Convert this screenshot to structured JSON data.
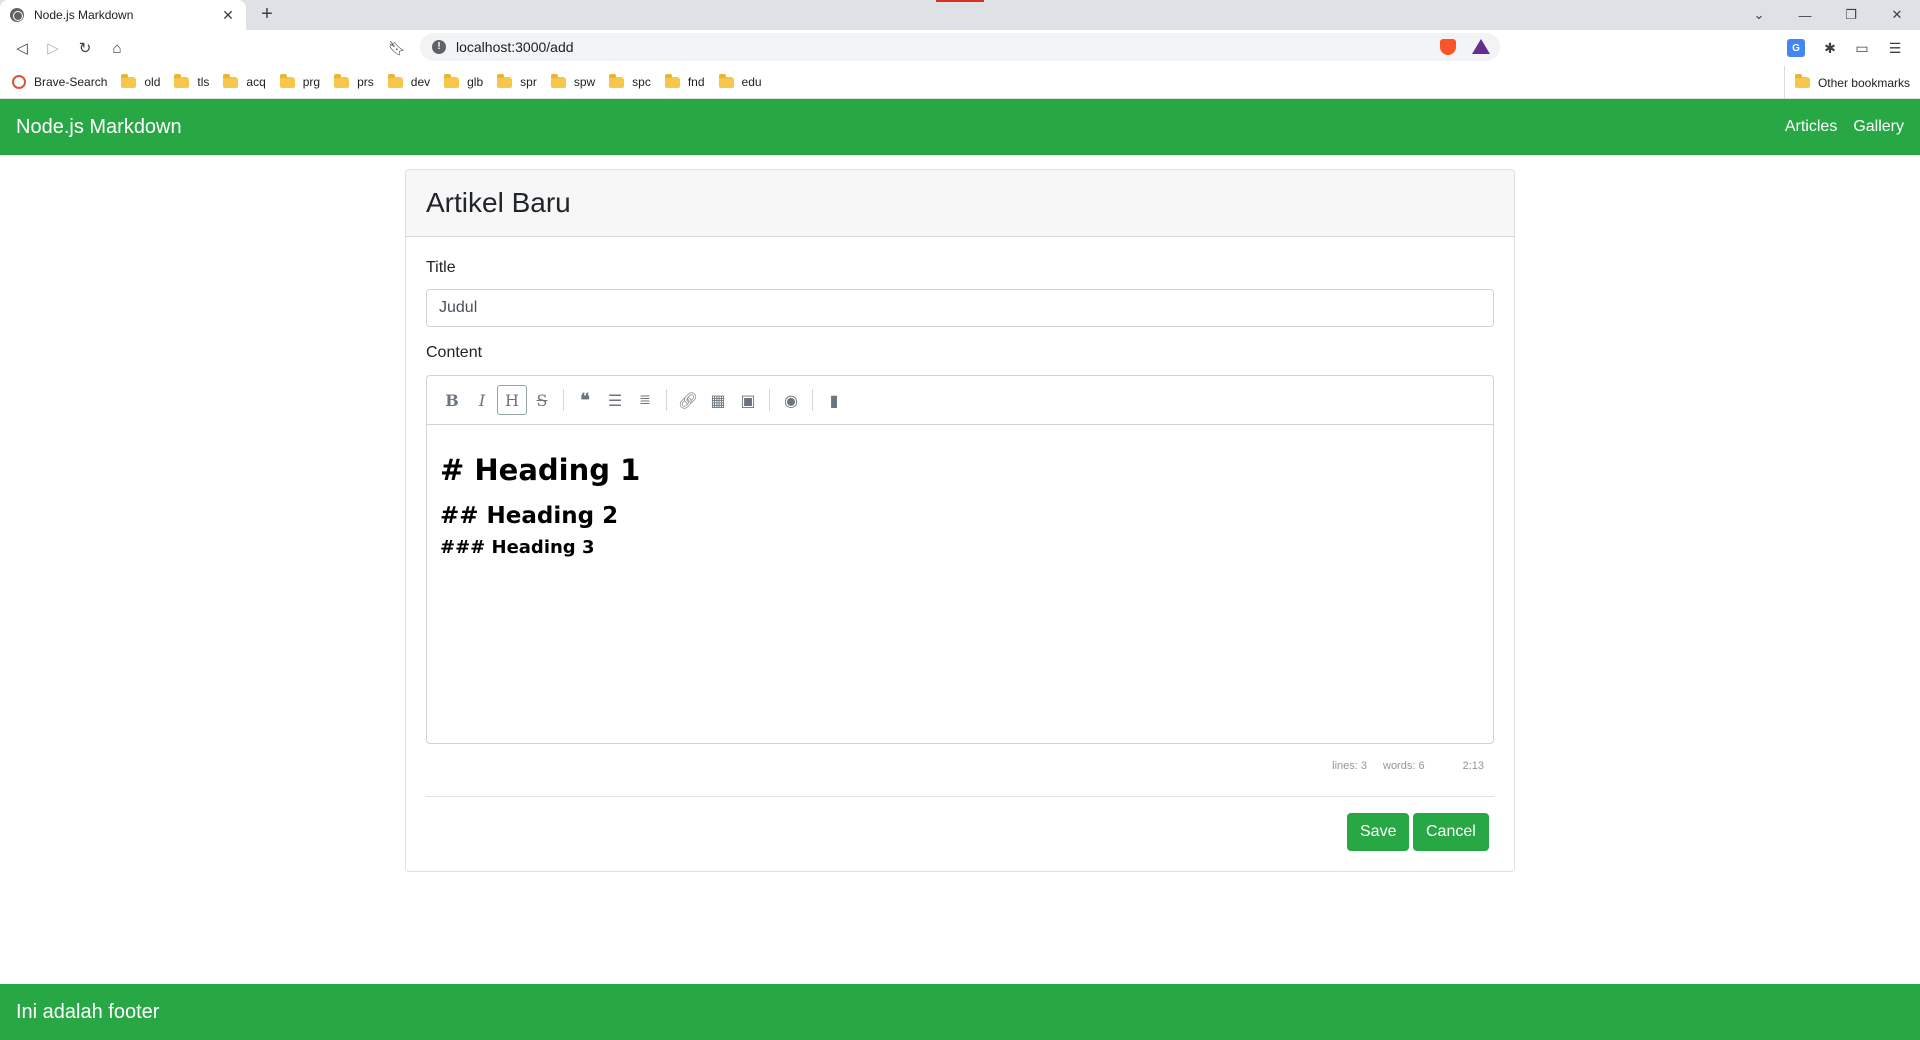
{
  "browser": {
    "tab_title": "Node.js Markdown",
    "tab_close": "✕",
    "new_tab": "+",
    "url": "localhost:3000/add",
    "bookmarks": [
      "Brave-Search",
      "old",
      "tls",
      "acq",
      "prg",
      "prs",
      "dev",
      "glb",
      "spr",
      "spw",
      "spc",
      "fnd",
      "edu"
    ],
    "other_bookmarks": "Other bookmarks"
  },
  "navbar": {
    "brand": "Node.js Markdown",
    "links": [
      "Articles",
      "Gallery"
    ]
  },
  "card": {
    "title": "Artikel Baru",
    "title_label": "Title",
    "title_value": "Judul",
    "content_label": "Content",
    "editor_lines": [
      "# Heading 1",
      "## Heading 2",
      "### Heading 3"
    ],
    "status": {
      "lines": "lines: 3",
      "words": "words: 6",
      "cursor": "2:13"
    },
    "save_label": "Save",
    "cancel_label": "Cancel"
  },
  "footer": {
    "text": "Ini adalah footer"
  },
  "colors": {
    "accent": "#28a745"
  }
}
